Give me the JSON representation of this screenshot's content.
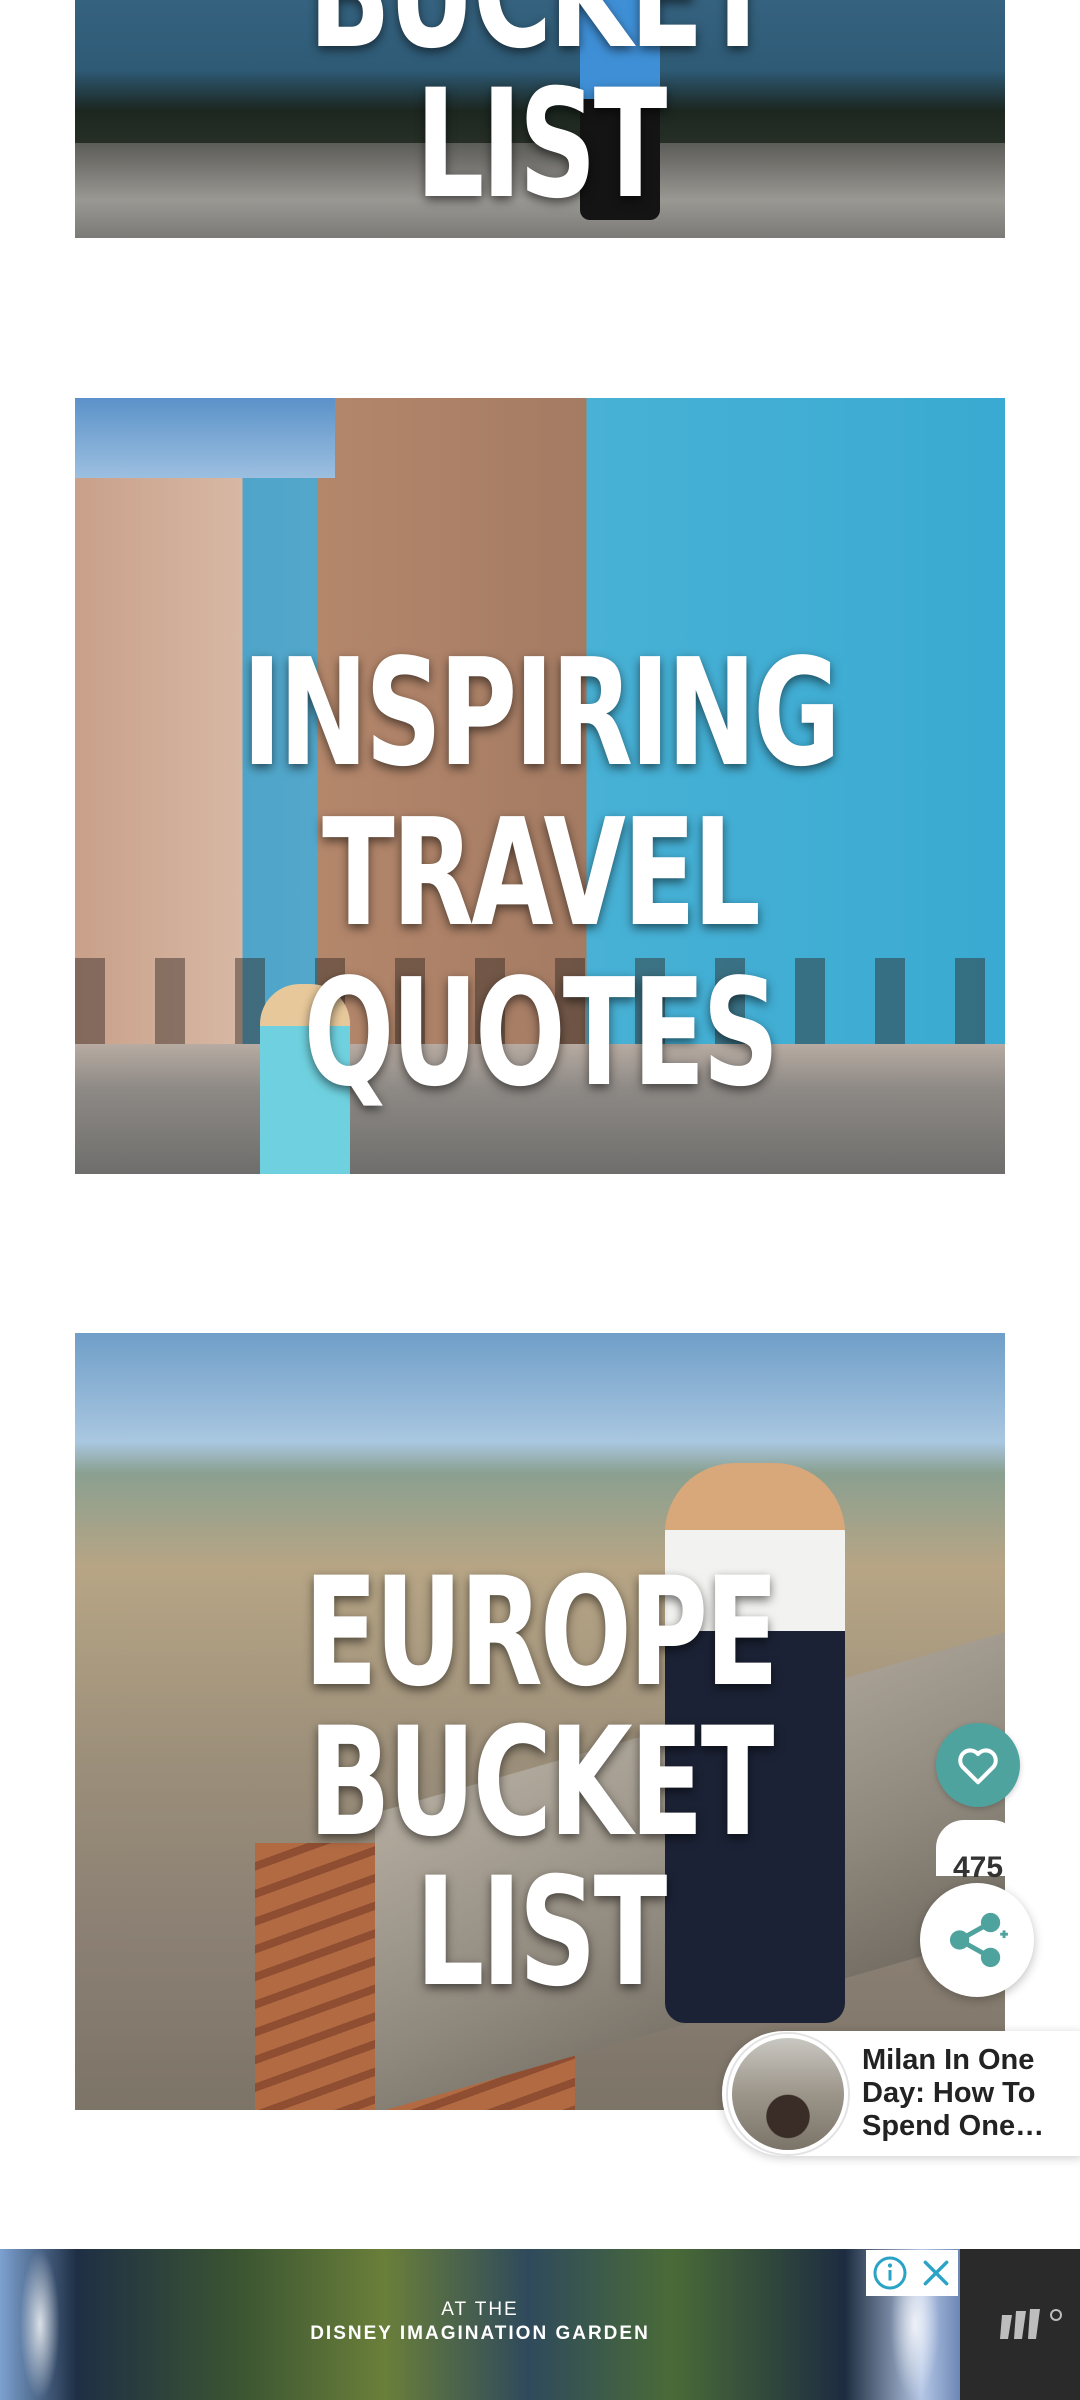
{
  "cards": [
    {
      "title": "BUCKET LIST"
    },
    {
      "title_line1": "INSPIRING",
      "title_line2": "TRAVEL QUOTES"
    },
    {
      "title_line1": "EUROPE BUCKET",
      "title_line2": "LIST"
    }
  ],
  "share": {
    "count": "475",
    "like_icon": "heart-icon",
    "share_icon": "share-icon"
  },
  "related": {
    "title": "Milan In One Day: How To Spend One…"
  },
  "ad": {
    "line1": "AT THE",
    "line2": "DISNEY IMAGINATION GARDEN"
  },
  "colors": {
    "accent": "#4fa39f"
  }
}
